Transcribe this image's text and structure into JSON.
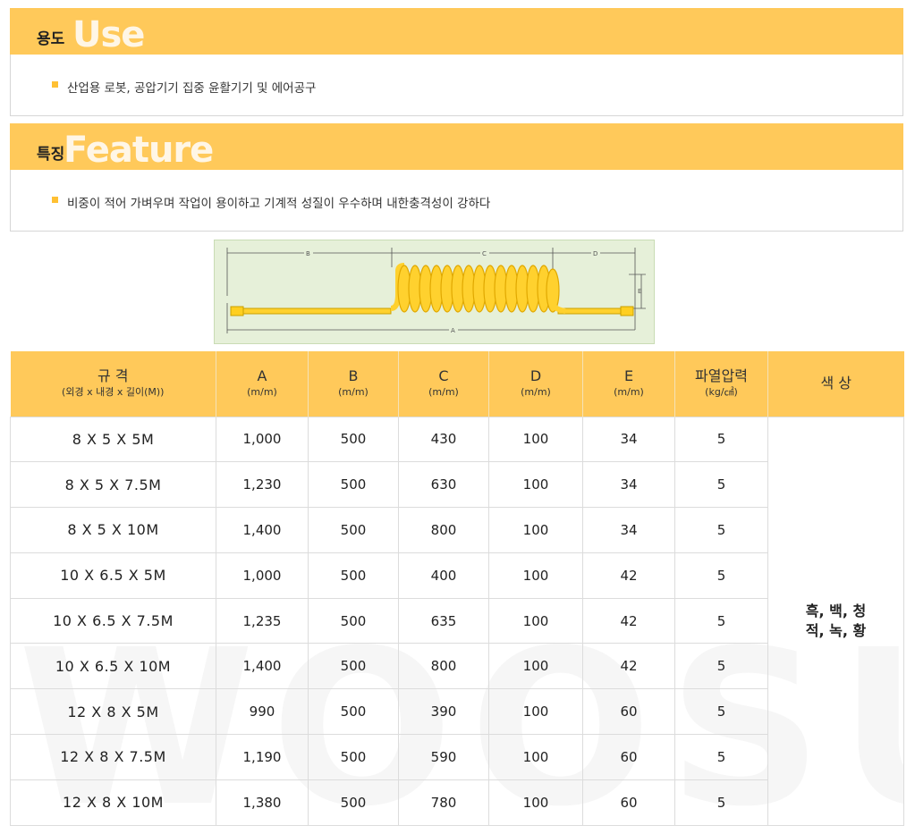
{
  "use": {
    "title_ko": "용도",
    "title_en": "Use",
    "text": "산업용 로봇, 공압기기 집중 윤활기기 및 에어공구"
  },
  "feature": {
    "title_ko": "특징",
    "title_en": "Feature",
    "text": "비중이 적어 가벼우며 작업이 용이하고 기계적 성질이 우수하며 내한충격성이 강하다"
  },
  "diagram": {
    "labels": {
      "a": "A",
      "b": "B",
      "c": "C",
      "d": "D",
      "e": "E"
    },
    "hose_color": "#ffd12e"
  },
  "table": {
    "headers": [
      {
        "main": "규 격",
        "sub": "(외경 x 내경 x 길이(M))"
      },
      {
        "main": "A",
        "sub": "(m/m)"
      },
      {
        "main": "B",
        "sub": "(m/m)"
      },
      {
        "main": "C",
        "sub": "(m/m)"
      },
      {
        "main": "D",
        "sub": "(m/m)"
      },
      {
        "main": "E",
        "sub": "(m/m)"
      },
      {
        "main": "파열압력",
        "sub": "(kg/㎠)"
      },
      {
        "main": "색 상",
        "sub": ""
      }
    ],
    "rows": [
      [
        "8 X 5 X 5M",
        "1,000",
        "500",
        "430",
        "100",
        "34",
        "5"
      ],
      [
        "8 X 5 X 7.5M",
        "1,230",
        "500",
        "630",
        "100",
        "34",
        "5"
      ],
      [
        "8 X 5 X 10M",
        "1,400",
        "500",
        "800",
        "100",
        "34",
        "5"
      ],
      [
        "10 X 6.5 X 5M",
        "1,000",
        "500",
        "400",
        "100",
        "42",
        "5"
      ],
      [
        "10 X 6.5 X 7.5M",
        "1,235",
        "500",
        "635",
        "100",
        "42",
        "5"
      ],
      [
        "10 X 6.5 X 10M",
        "1,400",
        "500",
        "800",
        "100",
        "42",
        "5"
      ],
      [
        "12 X 8 X 5M",
        "990",
        "500",
        "390",
        "100",
        "60",
        "5"
      ],
      [
        "12 X 8 X 7.5M",
        "1,190",
        "500",
        "590",
        "100",
        "60",
        "5"
      ],
      [
        "12 X 8 X 10M",
        "1,380",
        "500",
        "780",
        "100",
        "60",
        "5"
      ]
    ],
    "color_line1": "흑, 백, 청",
    "color_line2": "적, 녹, 황"
  },
  "watermark": "WOOSUNG",
  "colors": {
    "accent": "#ffc95a",
    "bullet": "#ffc033"
  }
}
